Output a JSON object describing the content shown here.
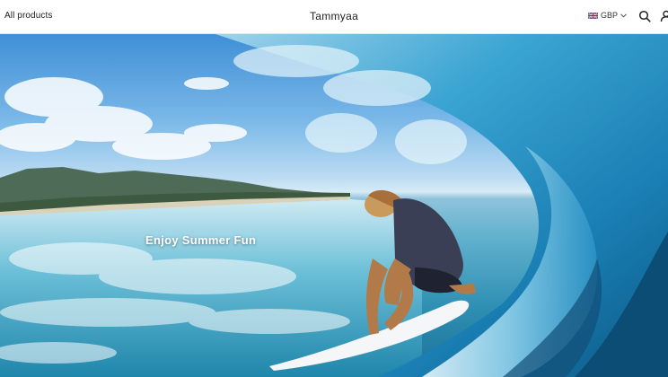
{
  "header": {
    "nav_link": "All products",
    "brand": "Tammyaa",
    "currency": "GBP",
    "flag_icon": "uk-flag-icon",
    "search_icon": "search-icon",
    "account_icon": "user-icon",
    "chevron_icon": "chevron-down-icon"
  },
  "hero": {
    "title": "Enjoy Summer Fun",
    "image": "surfer-riding-wave-photo"
  }
}
